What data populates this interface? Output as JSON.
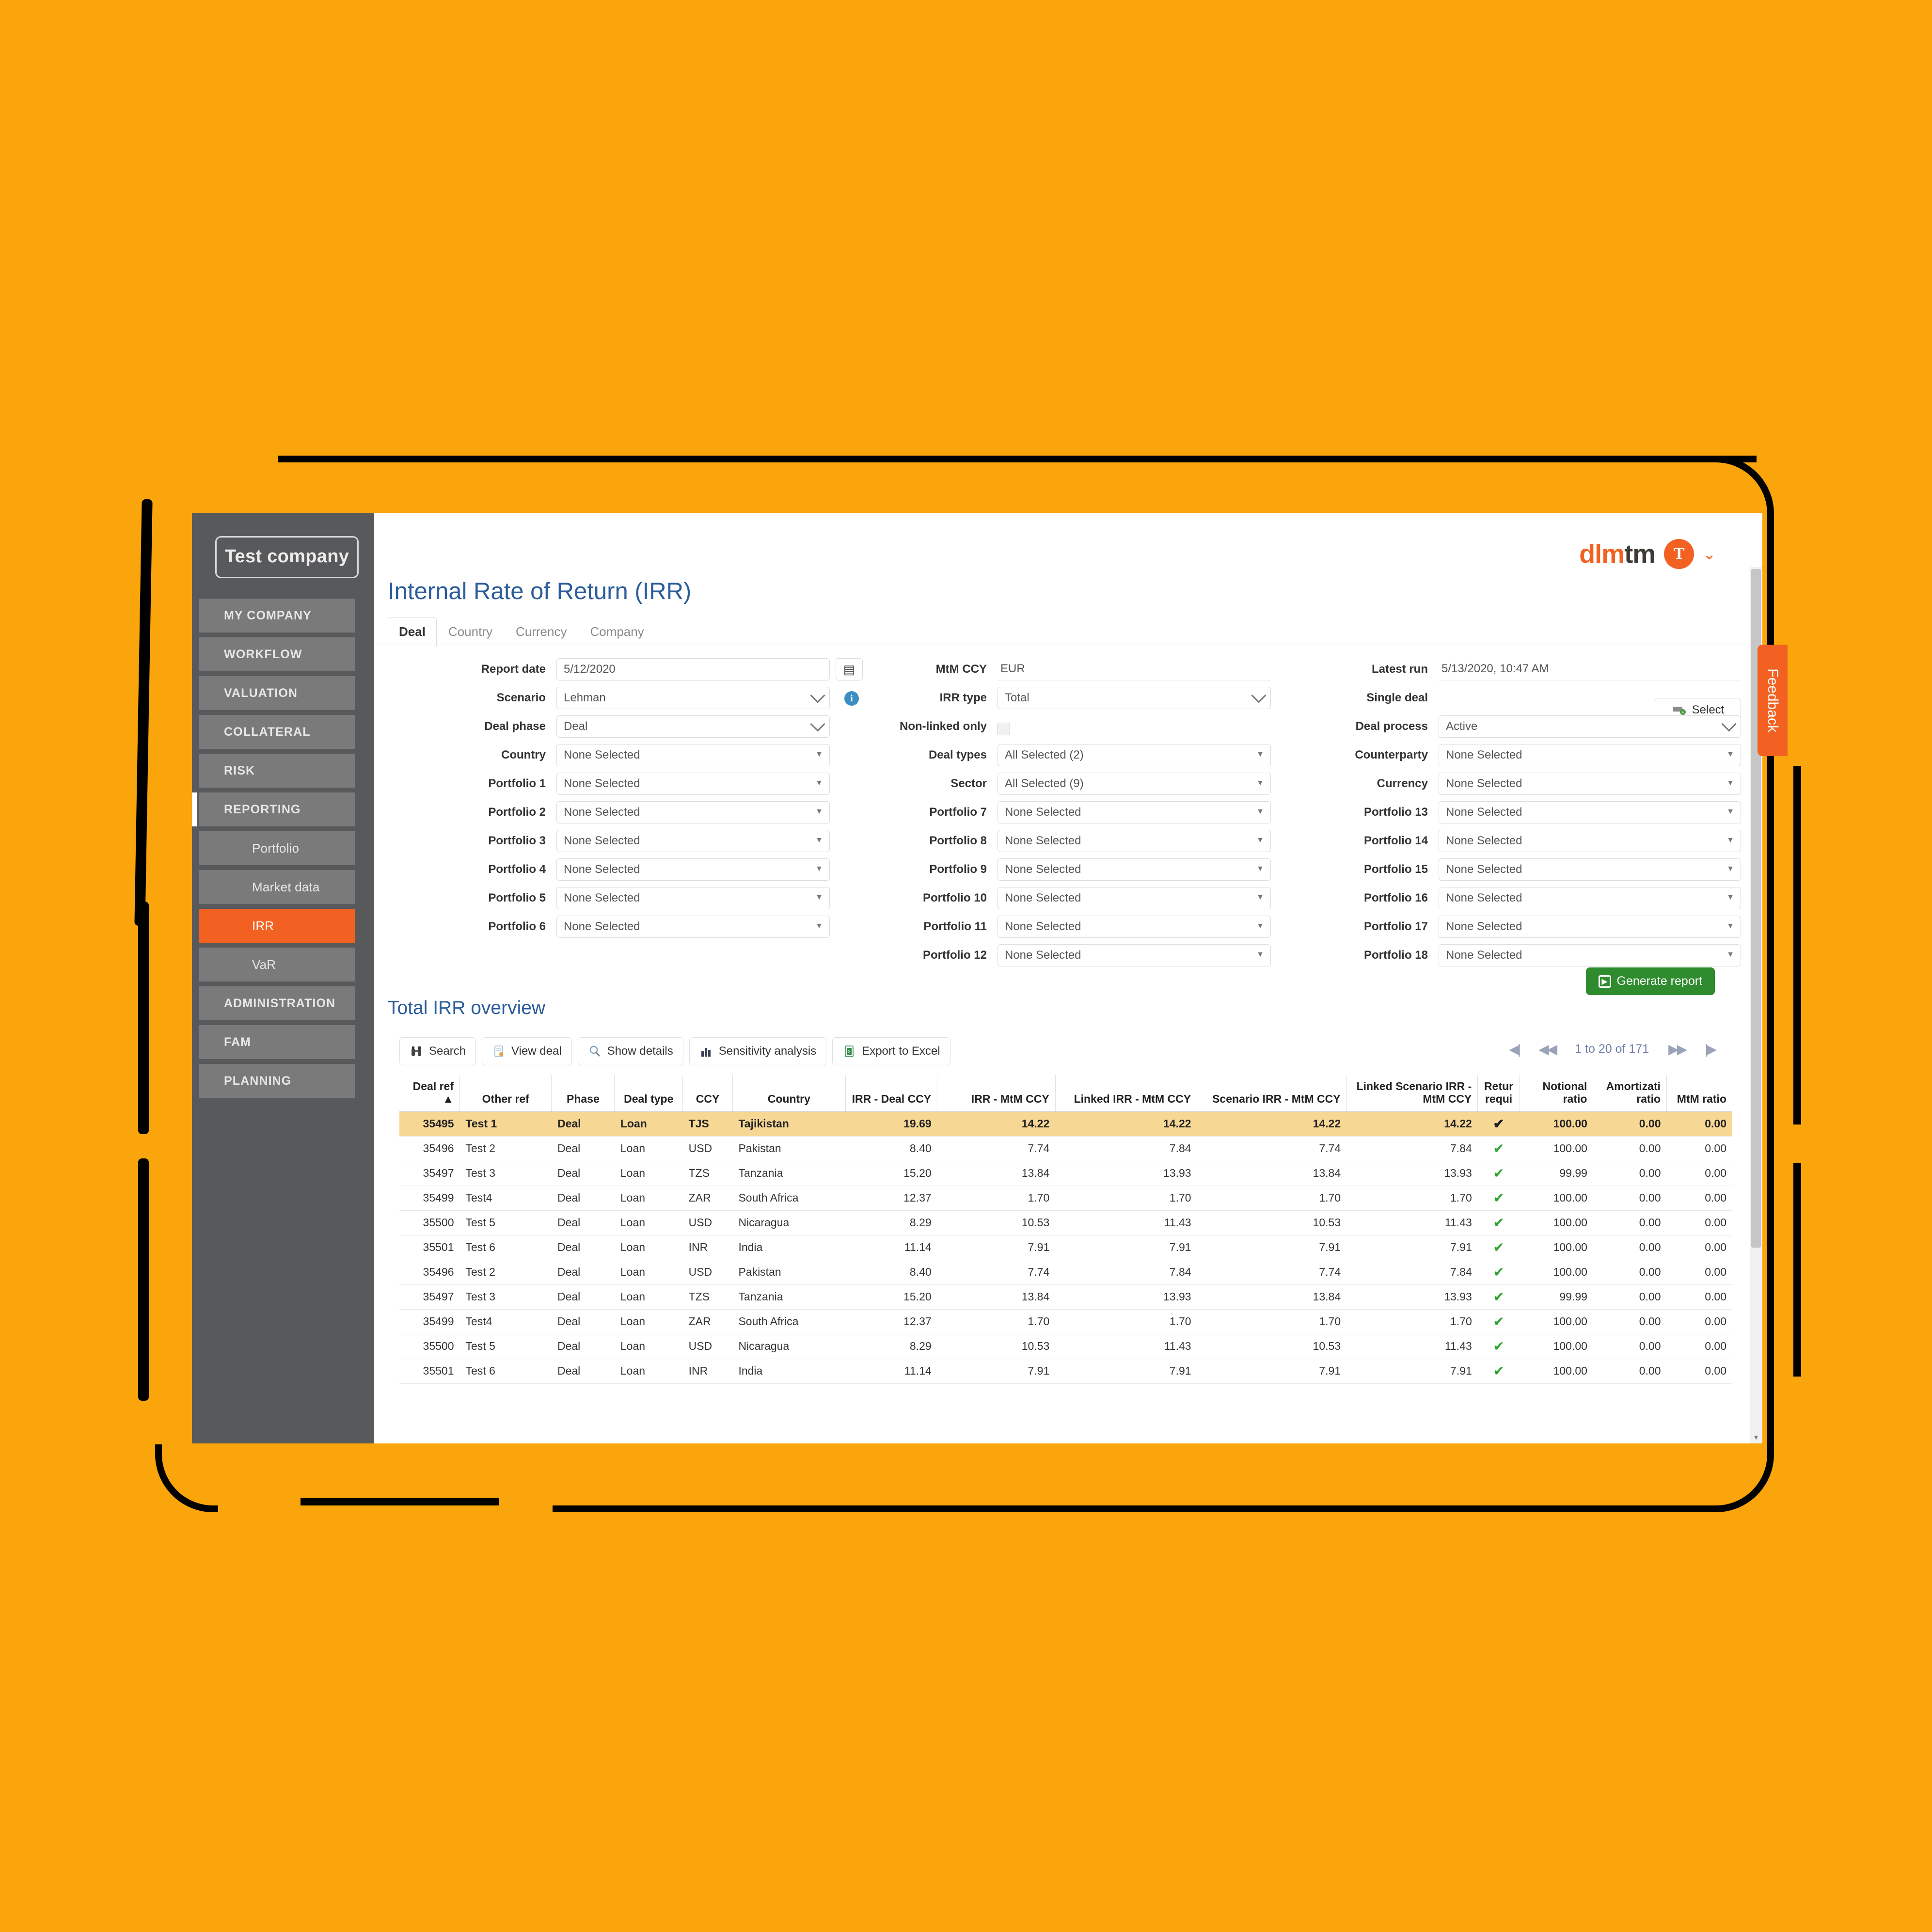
{
  "sidebar": {
    "company": "Test company",
    "items": [
      {
        "label": "MY COMPANY",
        "type": "parent"
      },
      {
        "label": "WORKFLOW",
        "type": "parent"
      },
      {
        "label": "VALUATION",
        "type": "parent"
      },
      {
        "label": "COLLATERAL",
        "type": "parent"
      },
      {
        "label": "RISK",
        "type": "parent"
      },
      {
        "label": "REPORTING",
        "type": "parent-active"
      },
      {
        "label": "Portfolio",
        "type": "sub"
      },
      {
        "label": "Market data",
        "type": "sub"
      },
      {
        "label": "IRR",
        "type": "sub-active"
      },
      {
        "label": "VaR",
        "type": "sub"
      },
      {
        "label": "ADMINISTRATION",
        "type": "parent"
      },
      {
        "label": "FAM",
        "type": "parent"
      },
      {
        "label": "PLANNING",
        "type": "parent"
      }
    ]
  },
  "header": {
    "logo_primary": "dlm",
    "logo_secondary": "tm",
    "avatar_initial": "T",
    "caret": "⌄"
  },
  "page": {
    "title": "Internal Rate of Return (IRR)",
    "tabs": [
      {
        "label": "Deal",
        "active": true
      },
      {
        "label": "Country",
        "active": false
      },
      {
        "label": "Currency",
        "active": false
      },
      {
        "label": "Company",
        "active": false
      }
    ]
  },
  "form": {
    "col1": [
      {
        "label": "Report date",
        "value": "5/12/2020",
        "control": "date"
      },
      {
        "label": "Scenario",
        "value": "Lehman",
        "control": "select-chevron",
        "info": true
      },
      {
        "label": "Deal phase",
        "value": "Deal",
        "control": "select-chevron"
      },
      {
        "label": "Country",
        "value": "None Selected",
        "control": "multiselect"
      },
      {
        "label": "Portfolio 1",
        "value": "None Selected",
        "control": "multiselect"
      },
      {
        "label": "Portfolio 2",
        "value": "None Selected",
        "control": "multiselect"
      },
      {
        "label": "Portfolio 3",
        "value": "None Selected",
        "control": "multiselect"
      },
      {
        "label": "Portfolio 4",
        "value": "None Selected",
        "control": "multiselect"
      },
      {
        "label": "Portfolio 5",
        "value": "None Selected",
        "control": "multiselect"
      },
      {
        "label": "Portfolio 6",
        "value": "None Selected",
        "control": "multiselect"
      }
    ],
    "col2": [
      {
        "label": "MtM CCY",
        "value": "EUR",
        "control": "static"
      },
      {
        "label": "IRR type",
        "value": "Total",
        "control": "select-chevron"
      },
      {
        "label": "Non-linked only",
        "value": "",
        "control": "checkbox"
      },
      {
        "label": "Deal types",
        "value": "All Selected (2)",
        "control": "multiselect"
      },
      {
        "label": "Sector",
        "value": "All Selected (9)",
        "control": "multiselect"
      },
      {
        "label": "Portfolio 7",
        "value": "None Selected",
        "control": "multiselect"
      },
      {
        "label": "Portfolio 8",
        "value": "None Selected",
        "control": "multiselect"
      },
      {
        "label": "Portfolio 9",
        "value": "None Selected",
        "control": "multiselect"
      },
      {
        "label": "Portfolio 10",
        "value": "None Selected",
        "control": "multiselect"
      },
      {
        "label": "Portfolio 11",
        "value": "None Selected",
        "control": "multiselect"
      },
      {
        "label": "Portfolio 12",
        "value": "None Selected",
        "control": "multiselect"
      }
    ],
    "col3": [
      {
        "label": "Latest run",
        "value": "5/13/2020, 10:47 AM",
        "control": "static"
      },
      {
        "label": "Single deal",
        "value": "Select",
        "control": "button"
      },
      {
        "label": "Deal process",
        "value": "Active",
        "control": "select-chevron"
      },
      {
        "label": "Counterparty",
        "value": "None Selected",
        "control": "multiselect"
      },
      {
        "label": "Currency",
        "value": "None Selected",
        "control": "multiselect"
      },
      {
        "label": "Portfolio 13",
        "value": "None Selected",
        "control": "multiselect"
      },
      {
        "label": "Portfolio 14",
        "value": "None Selected",
        "control": "multiselect"
      },
      {
        "label": "Portfolio 15",
        "value": "None Selected",
        "control": "multiselect"
      },
      {
        "label": "Portfolio 16",
        "value": "None Selected",
        "control": "multiselect"
      },
      {
        "label": "Portfolio 17",
        "value": "None Selected",
        "control": "multiselect"
      },
      {
        "label": "Portfolio 18",
        "value": "None Selected",
        "control": "multiselect"
      }
    ],
    "generate_label": "Generate report"
  },
  "overview": {
    "title": "Total IRR overview",
    "toolbar": [
      {
        "label": "Search",
        "icon": "binoculars-icon"
      },
      {
        "label": "View deal",
        "icon": "document-icon"
      },
      {
        "label": "Show details",
        "icon": "magnifier-icon"
      },
      {
        "label": "Sensitivity analysis",
        "icon": "bar-chart-icon"
      },
      {
        "label": "Export to Excel",
        "icon": "excel-icon"
      }
    ],
    "pager": {
      "first": "◀|",
      "prev": "◀◀",
      "range": "1 to 20 of 171",
      "next": "▶▶",
      "last": "|▶"
    },
    "columns": [
      "Deal ref ▲",
      "Other ref",
      "Phase",
      "Deal type",
      "CCY",
      "Country",
      "IRR - Deal CCY",
      "IRR - MtM CCY",
      "Linked IRR - MtM CCY",
      "Scenario IRR - MtM CCY",
      "Linked Scenario IRR - MtM CCY",
      "Retur requi",
      "Notional ratio",
      "Amortizati ratio",
      "MtM ratio"
    ],
    "rows": [
      {
        "selected": true,
        "deal_ref": "35495",
        "other_ref": "Test 1",
        "phase": "Deal",
        "deal_type": "Loan",
        "ccy": "TJS",
        "country": "Tajikistan",
        "irr_deal": "19.69",
        "irr_mtm": "14.22",
        "linked_irr": "14.22",
        "scen_irr": "14.22",
        "linked_scen": "14.22",
        "ret_req": "✔",
        "notional": "100.00",
        "amort": "0.00",
        "mtm_ratio": "0.00"
      },
      {
        "selected": false,
        "deal_ref": "35496",
        "other_ref": "Test 2",
        "phase": "Deal",
        "deal_type": "Loan",
        "ccy": "USD",
        "country": "Pakistan",
        "irr_deal": "8.40",
        "irr_mtm": "7.74",
        "linked_irr": "7.84",
        "scen_irr": "7.74",
        "linked_scen": "7.84",
        "ret_req": "✔",
        "notional": "100.00",
        "amort": "0.00",
        "mtm_ratio": "0.00"
      },
      {
        "selected": false,
        "deal_ref": "35497",
        "other_ref": "Test 3",
        "phase": "Deal",
        "deal_type": "Loan",
        "ccy": "TZS",
        "country": "Tanzania",
        "irr_deal": "15.20",
        "irr_mtm": "13.84",
        "linked_irr": "13.93",
        "scen_irr": "13.84",
        "linked_scen": "13.93",
        "ret_req": "✔",
        "notional": "99.99",
        "amort": "0.00",
        "mtm_ratio": "0.00"
      },
      {
        "selected": false,
        "deal_ref": "35499",
        "other_ref": "Test4",
        "phase": "Deal",
        "deal_type": "Loan",
        "ccy": "ZAR",
        "country": "South Africa",
        "irr_deal": "12.37",
        "irr_mtm": "1.70",
        "linked_irr": "1.70",
        "scen_irr": "1.70",
        "linked_scen": "1.70",
        "ret_req": "✔",
        "notional": "100.00",
        "amort": "0.00",
        "mtm_ratio": "0.00"
      },
      {
        "selected": false,
        "deal_ref": "35500",
        "other_ref": "Test 5",
        "phase": "Deal",
        "deal_type": "Loan",
        "ccy": "USD",
        "country": "Nicaragua",
        "irr_deal": "8.29",
        "irr_mtm": "10.53",
        "linked_irr": "11.43",
        "scen_irr": "10.53",
        "linked_scen": "11.43",
        "ret_req": "✔",
        "notional": "100.00",
        "amort": "0.00",
        "mtm_ratio": "0.00"
      },
      {
        "selected": false,
        "deal_ref": "35501",
        "other_ref": "Test 6",
        "phase": "Deal",
        "deal_type": "Loan",
        "ccy": "INR",
        "country": "India",
        "irr_deal": "11.14",
        "irr_mtm": "7.91",
        "linked_irr": "7.91",
        "scen_irr": "7.91",
        "linked_scen": "7.91",
        "ret_req": "✔",
        "notional": "100.00",
        "amort": "0.00",
        "mtm_ratio": "0.00"
      },
      {
        "selected": false,
        "deal_ref": "35496",
        "other_ref": "Test 2",
        "phase": "Deal",
        "deal_type": "Loan",
        "ccy": "USD",
        "country": "Pakistan",
        "irr_deal": "8.40",
        "irr_mtm": "7.74",
        "linked_irr": "7.84",
        "scen_irr": "7.74",
        "linked_scen": "7.84",
        "ret_req": "✔",
        "notional": "100.00",
        "amort": "0.00",
        "mtm_ratio": "0.00"
      },
      {
        "selected": false,
        "deal_ref": "35497",
        "other_ref": "Test 3",
        "phase": "Deal",
        "deal_type": "Loan",
        "ccy": "TZS",
        "country": "Tanzania",
        "irr_deal": "15.20",
        "irr_mtm": "13.84",
        "linked_irr": "13.93",
        "scen_irr": "13.84",
        "linked_scen": "13.93",
        "ret_req": "✔",
        "notional": "99.99",
        "amort": "0.00",
        "mtm_ratio": "0.00"
      },
      {
        "selected": false,
        "deal_ref": "35499",
        "other_ref": "Test4",
        "phase": "Deal",
        "deal_type": "Loan",
        "ccy": "ZAR",
        "country": "South Africa",
        "irr_deal": "12.37",
        "irr_mtm": "1.70",
        "linked_irr": "1.70",
        "scen_irr": "1.70",
        "linked_scen": "1.70",
        "ret_req": "✔",
        "notional": "100.00",
        "amort": "0.00",
        "mtm_ratio": "0.00"
      },
      {
        "selected": false,
        "deal_ref": "35500",
        "other_ref": "Test 5",
        "phase": "Deal",
        "deal_type": "Loan",
        "ccy": "USD",
        "country": "Nicaragua",
        "irr_deal": "8.29",
        "irr_mtm": "10.53",
        "linked_irr": "11.43",
        "scen_irr": "10.53",
        "linked_scen": "11.43",
        "ret_req": "✔",
        "notional": "100.00",
        "amort": "0.00",
        "mtm_ratio": "0.00"
      },
      {
        "selected": false,
        "deal_ref": "35501",
        "other_ref": "Test 6",
        "phase": "Deal",
        "deal_type": "Loan",
        "ccy": "INR",
        "country": "India",
        "irr_deal": "11.14",
        "irr_mtm": "7.91",
        "linked_irr": "7.91",
        "scen_irr": "7.91",
        "linked_scen": "7.91",
        "ret_req": "✔",
        "notional": "100.00",
        "amort": "0.00",
        "mtm_ratio": "0.00"
      }
    ]
  },
  "feedback": {
    "label": "Feedback"
  },
  "colors": {
    "background": "#F9A50B",
    "accent": "#F26122",
    "sidebar": "#58595B",
    "title": "#2B5C9B",
    "row_selected": "#F7D794",
    "generate": "#2E8B2E",
    "tick": "#2ea32e"
  }
}
